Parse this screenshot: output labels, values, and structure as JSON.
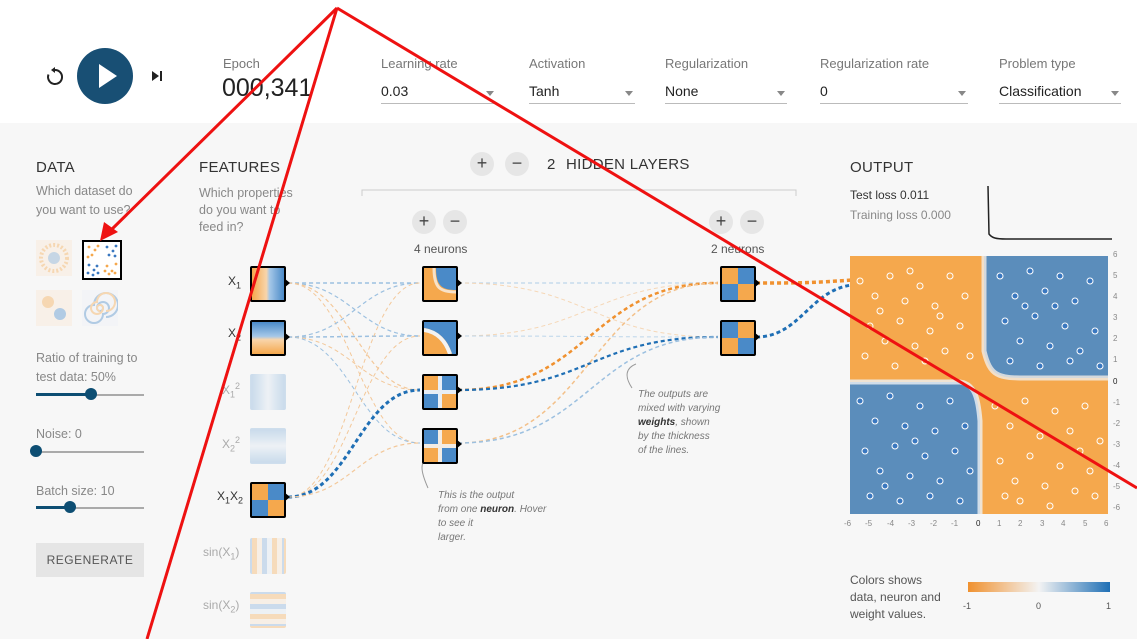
{
  "controls": {
    "epoch_label": "Epoch",
    "epoch_value": "000,341",
    "learning_rate_label": "Learning rate",
    "learning_rate_value": "0.03",
    "activation_label": "Activation",
    "activation_value": "Tanh",
    "regularization_label": "Regularization",
    "regularization_value": "None",
    "regularization_rate_label": "Regularization rate",
    "regularization_rate_value": "0",
    "problem_type_label": "Problem type",
    "problem_type_value": "Classification"
  },
  "data_panel": {
    "title": "DATA",
    "subtitle_1": "Which dataset do",
    "subtitle_2": "you want to use?",
    "ratio_label_1": "Ratio of training to",
    "ratio_label_2": "test data:  50%",
    "ratio_value": 0.5,
    "noise_label": "Noise:  0",
    "noise_value": 0,
    "batch_label": "Batch size:  10",
    "batch_value": 0.33,
    "regenerate_label": "REGENERATE"
  },
  "features_panel": {
    "title": "FEATURES",
    "subtitle_1": "Which properties",
    "subtitle_2": "do you want to",
    "subtitle_3": "feed in?",
    "items": [
      {
        "base": "X",
        "sub": "1",
        "sup": "",
        "active": true
      },
      {
        "base": "X",
        "sub": "2",
        "sup": "",
        "active": true
      },
      {
        "base": "X",
        "sub": "1",
        "sup": "2",
        "active": false
      },
      {
        "base": "X",
        "sub": "2",
        "sup": "2",
        "active": false
      },
      {
        "base": "X",
        "sub": "1",
        "base2": "X",
        "sub2": "2",
        "active": true
      },
      {
        "base": "sin(X",
        "sub": "1",
        "tail": ")",
        "active": false
      },
      {
        "base": "sin(X",
        "sub": "2",
        "tail": ")",
        "active": false
      }
    ]
  },
  "network": {
    "plus": "+",
    "minus": "−",
    "layers_count": "2",
    "layers_label": "HIDDEN LAYERS",
    "layer1_neurons": "4 neurons",
    "layer2_neurons": "2 neurons",
    "note_neuron_1": "This is the output",
    "note_neuron_2": "from one ",
    "note_neuron_bold": "neuron",
    "note_neuron_3": ". Hover to see it",
    "note_neuron_4": "larger.",
    "note_weights_1": "The outputs are",
    "note_weights_2": "mixed with varying",
    "note_weights_bold": "weights",
    "note_weights_3": ", shown",
    "note_weights_4": "by the thickness",
    "note_weights_5": "of the lines."
  },
  "output_panel": {
    "title": "OUTPUT",
    "test_loss": "Test loss 0.011",
    "training_loss": "Training loss 0.000",
    "y_ticks": [
      "6",
      "5",
      "4",
      "3",
      "2",
      "1",
      "0",
      "-1",
      "-2",
      "-3",
      "-4",
      "-5",
      "-6"
    ],
    "x_ticks": [
      "-6",
      "-5",
      "-4",
      "-3",
      "-2",
      "-1",
      "0",
      "1",
      "2",
      "3",
      "4",
      "5",
      "6"
    ],
    "legend_1": "Colors shows",
    "legend_2": "data, neuron and",
    "legend_3": "weight values.",
    "legend_min": "-1",
    "legend_mid": "0",
    "legend_max": "1"
  },
  "colors": {
    "orange": "#f5a84d",
    "blue": "#4a8ac8",
    "dark_blue": "#0d4e73",
    "annotation_red": "#ee1111"
  }
}
